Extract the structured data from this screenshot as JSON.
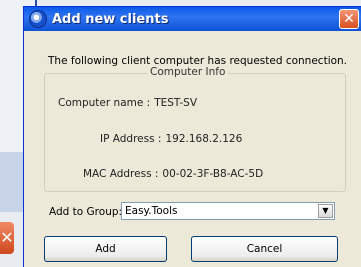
{
  "dialog": {
    "title": "Add new clients",
    "close_label": "✕",
    "message": "The following client computer has requested connection.",
    "computer_info": {
      "title": "Computer Info",
      "fields": [
        {
          "label": "Computer name :",
          "value": "TEST-SV"
        },
        {
          "label": "IP Address :",
          "value": "192.168.2.126"
        },
        {
          "label": "MAC Address :",
          "value": "00-02-3F-B8-AC-5D"
        }
      ]
    },
    "group_label": "Add to Group:",
    "group_selected": "Easy.Tools",
    "add_label": "Add",
    "cancel_label": "Cancel"
  },
  "background": {
    "close_label": "✕"
  }
}
